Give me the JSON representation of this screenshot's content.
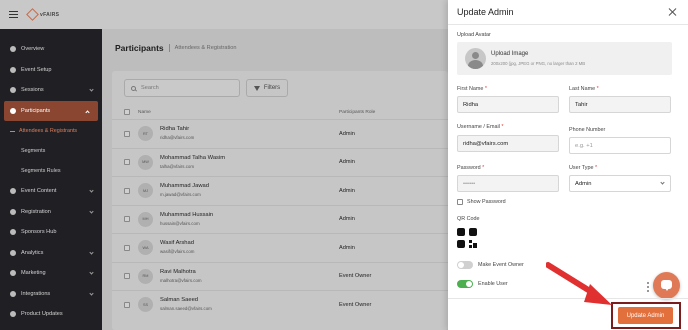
{
  "topbar": {
    "brand": "vFAIRS"
  },
  "sidebar": {
    "items": [
      {
        "label": "Overview",
        "icon": "overview-icon",
        "expandable": false
      },
      {
        "label": "Event Setup",
        "icon": "gear-icon",
        "expandable": false
      },
      {
        "label": "Sessions",
        "icon": "sessions-icon",
        "expandable": true
      },
      {
        "label": "Participants",
        "icon": "participants-icon",
        "expandable": true,
        "active": true
      },
      {
        "label": "Event Content",
        "icon": "content-icon",
        "expandable": true
      },
      {
        "label": "Registration",
        "icon": "registration-icon",
        "expandable": true
      },
      {
        "label": "Sponsors Hub",
        "icon": "sponsors-icon",
        "expandable": false
      },
      {
        "label": "Analytics",
        "icon": "analytics-icon",
        "expandable": true
      },
      {
        "label": "Marketing",
        "icon": "marketing-icon",
        "expandable": true
      },
      {
        "label": "Integrations",
        "icon": "integrations-icon",
        "expandable": true
      },
      {
        "label": "Product Updates",
        "icon": "updates-icon",
        "expandable": false
      }
    ],
    "subitems": [
      "Attendees & Registrants",
      "Segments",
      "Segments Rules"
    ]
  },
  "main": {
    "title": "Participants",
    "subtitle": "Attendees & Registration",
    "search_placeholder": "Search",
    "filters_label": "Filters",
    "columns": {
      "name": "Name",
      "role": "Participants Role"
    },
    "rows": [
      {
        "initials": "RT",
        "name": "Ridha Tahir",
        "email": "ridha@vfairs.com",
        "role": "Admin"
      },
      {
        "initials": "MW",
        "name": "Mohammad Talha Wasim",
        "email": "talha@vfairs.com",
        "role": "Admin"
      },
      {
        "initials": "MJ",
        "name": "Muhammad Jawad",
        "email": "m.jawad@vfairs.com",
        "role": "Admin"
      },
      {
        "initials": "MH",
        "name": "Muhammad Hussain",
        "email": "hussain@vfairs.com",
        "role": "Admin"
      },
      {
        "initials": "WA",
        "name": "Wasif Arshad",
        "email": "wasif@vfairs.com",
        "role": "Admin"
      },
      {
        "initials": "RM",
        "name": "Ravi Malhotra",
        "email": "malhotra@vfairs.com",
        "role": "Event Owner"
      },
      {
        "initials": "SS",
        "name": "Salman Saeed",
        "email": "salman.saeed@vfairs.com",
        "role": "Event Owner"
      }
    ]
  },
  "modal": {
    "title": "Update Admin",
    "upload_label": "Upload Avatar",
    "upload_title": "Upload Image",
    "upload_hint": "200x200 (jpg, JPEG or PNG, no larger than 2 MB",
    "first_name_label": "First Name",
    "first_name_value": "Ridha",
    "last_name_label": "Last Name",
    "last_name_value": "Tahir",
    "email_label": "Username / Email",
    "email_value": "ridha@vfairs.com",
    "phone_label": "Phone Number",
    "phone_placeholder": "e.g. +1",
    "password_label": "Password",
    "password_value": "••••••",
    "user_type_label": "User Type",
    "user_type_value": "Admin",
    "show_password_label": "Show Password",
    "qr_label": "QR Code",
    "make_owner_label": "Make Event Owner",
    "make_owner_enabled": false,
    "enable_user_label": "Enable User",
    "enable_user_enabled": true,
    "update_button": "Update Admin"
  },
  "colors": {
    "accent": "#e2703d",
    "sidebar_bg": "#1f1f24",
    "active_nav": "#8a4630",
    "toggle_on": "#4caf50",
    "required": "#e53935"
  }
}
